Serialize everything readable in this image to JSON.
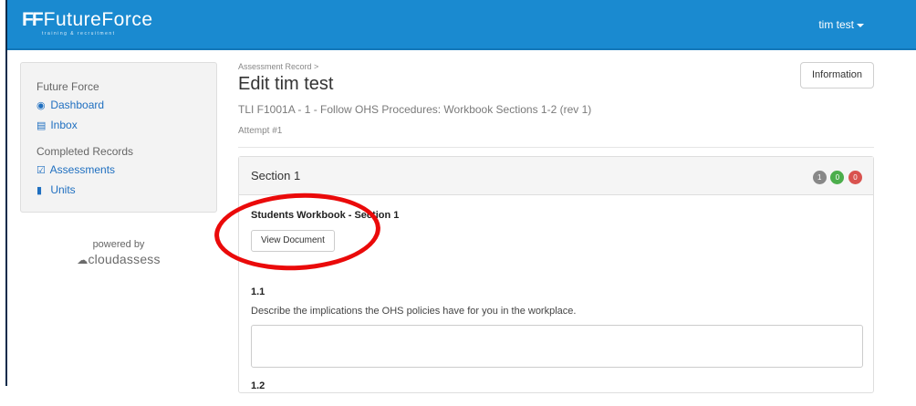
{
  "navbar": {
    "logo_mark": "FF",
    "logo_text": "FutureForce",
    "logo_sub": "training & recruitment",
    "user": "tim test"
  },
  "sidebar": {
    "heading1": "Future Force",
    "links1": [
      {
        "icon": "dashboard-icon",
        "label": "Dashboard"
      },
      {
        "icon": "inbox-icon",
        "label": "Inbox"
      }
    ],
    "heading2": "Completed Records",
    "links2": [
      {
        "icon": "checkbox-icon",
        "label": "Assessments"
      },
      {
        "icon": "book-icon",
        "label": "Units"
      }
    ],
    "powered_by": "powered by",
    "brand": "cloudassess"
  },
  "main": {
    "breadcrumb": "Assessment Record >",
    "title": "Edit tim test",
    "subtitle": "TLI F1001A - 1 - Follow OHS Procedures: Workbook Sections 1-2 (rev 1)",
    "attempt": "Attempt #1",
    "info_button": "Information"
  },
  "section": {
    "title": "Section 1",
    "badges": [
      "1",
      "0",
      "0"
    ],
    "workbook_title": "Students Workbook - Section 1",
    "view_button": "View Document",
    "q1_num": "1.1",
    "q1_text": "Describe the implications the OHS policies have for you in the workplace.",
    "q2_num": "1.2"
  },
  "colors": {
    "navbar": "#1a8ad0",
    "link": "#1f6fc0",
    "annotation": "#ea0a0a"
  }
}
